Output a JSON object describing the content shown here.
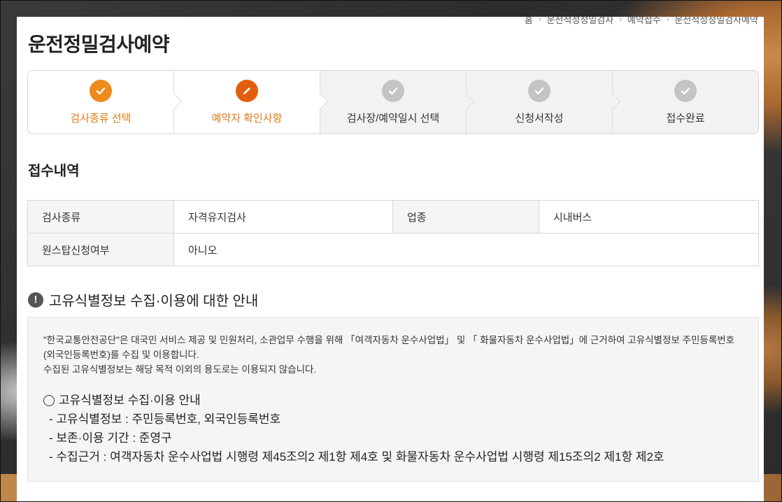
{
  "breadcrumb": [
    "홈",
    "운전적성정밀검사",
    "예약접수",
    "운전적성정밀검사예약"
  ],
  "page_title": "운전정밀검사예약",
  "steps": [
    {
      "label": "검사종류 선택",
      "state": "done",
      "icon": "check-icon"
    },
    {
      "label": "예약자 확인사항",
      "state": "active",
      "icon": "pencil-icon"
    },
    {
      "label": "검사장/예약일시 선택",
      "state": "pending",
      "icon": "check-icon"
    },
    {
      "label": "신청서작성",
      "state": "pending",
      "icon": "check-icon"
    },
    {
      "label": "접수완료",
      "state": "pending",
      "icon": "check-icon"
    }
  ],
  "reception": {
    "title": "접수내역",
    "rows": [
      {
        "label1": "검사종류",
        "value1": "자격유지검사",
        "label2": "업종",
        "value2": "시내버스"
      },
      {
        "label1": "원스탑신청여부",
        "value1": "아니오"
      }
    ]
  },
  "notice": {
    "heading": "고유식별정보 수집·이용에 대한 안내",
    "para1": "\"한국교통안전공단\"은 대국민 서비스 제공 및 민원처리, 소관업무 수행을 위해 「여객자동차 운수사업법」 및 「 화물자동차 운수사업법」에 근거하여 고유식별정보 주민등록번호(외국인등록번호)를 수집 및 이용합니다.",
    "para2": "수집된 고유식별정보는 해당 목적 이외의 용도로는 이용되지 않습니다.",
    "list_title": "고유식별정보 수집·이용 안내",
    "items": [
      "- 고유식별정보 : 주민등록번호, 외국인등록번호",
      "- 보존·이용 기간 : 준영구",
      "- 수집근거 : 여객자동차 운수사업법 시행령 제45조의2 제1항 제4호 및 화물자동차 운수사업법 시행령 제15조의2 제1항 제2호"
    ]
  },
  "colors": {
    "done": "#ee8a1e",
    "active": "#e45d0f",
    "pending": "#c4c4c4"
  }
}
